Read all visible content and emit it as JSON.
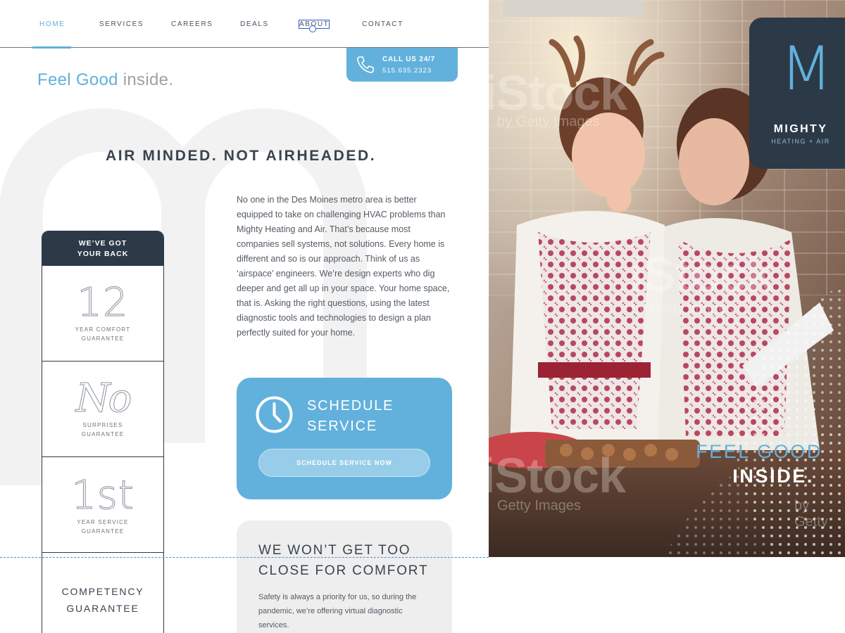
{
  "nav": {
    "items": [
      {
        "label": "HOME",
        "state": "active"
      },
      {
        "label": "SERVICES",
        "state": "default"
      },
      {
        "label": "CAREERS",
        "state": "default"
      },
      {
        "label": "DEALS",
        "state": "default"
      },
      {
        "label": "ABOUT",
        "state": "selected"
      },
      {
        "label": "CONTACT",
        "state": "default"
      }
    ]
  },
  "call": {
    "line1": "CALL US 24/7",
    "line2": "515.635.2323"
  },
  "tagline": {
    "highlight": "Feel Good",
    "rest": " inside."
  },
  "headline": "AIR MINDED. NOT AIRHEADED.",
  "body_text": "No one in the Des Moines metro area is better equipped to take on challenging HVAC problems than Mighty Heating and Air. That’s because most companies sell systems, not solutions. Every home is different and so is our approach. Think of us as ‘airspace’ engineers. We’re design experts who dig deeper and get all up in your space. Your home space, that is. Asking the right questions, using the latest diagnostic tools and technologies to design a plan perfectly suited for your home.",
  "guarantees": {
    "header_line1": "WE’VE GOT",
    "header_line2": "YOUR BACK",
    "items": [
      {
        "big": "12",
        "line1": "YEAR COMFORT",
        "line2": "GUARANTEE"
      },
      {
        "big": "No",
        "line1": "SURPRISES",
        "line2": "GUARANTEE"
      },
      {
        "big": "1st",
        "line1": "YEAR SERVICE",
        "line2": "GUARANTEE"
      },
      {
        "big": "",
        "line1": "COMPETENCY",
        "line2": "GUARANTEE"
      }
    ]
  },
  "schedule": {
    "title_line1": "SCHEDULE",
    "title_line2": "SERVICE",
    "button": "SCHEDULE SERVICE NOW"
  },
  "comfort": {
    "title_line1": "WE WON’T GET TOO",
    "title_line2": "CLOSE FOR COMFORT",
    "text": "Safety is always a priority for us, so during the pandemic, we’re offering virtual diagnostic services."
  },
  "hero": {
    "watermarks": [
      "iStock",
      "by Getty Images",
      "iStock",
      "by Getty Images",
      "iStock",
      "Getty Images",
      "by Getty"
    ],
    "logo_letter": "M",
    "logo_name": "MIGHTY",
    "logo_sub": "HEATING + AIR",
    "tagline_line1": "FEEL GOOD",
    "tagline_line2": "INSIDE."
  },
  "colors": {
    "accent": "#62b1dc",
    "navy": "#2c3a48",
    "card_gray": "#eeeeee"
  },
  "icons": [
    "phone-icon",
    "clock-icon"
  ]
}
